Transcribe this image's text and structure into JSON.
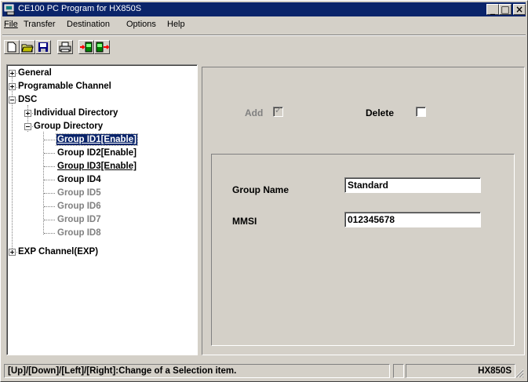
{
  "window": {
    "title": "CE100  PC Program for HX850S",
    "controls": [
      "minimize-icon",
      "maximize-icon",
      "close-icon"
    ]
  },
  "menu": {
    "file": "File",
    "transfer": "Transfer",
    "destination": "Destination",
    "options": "Options",
    "help": "Help"
  },
  "toolbar": {
    "buttons": [
      "new-file-icon",
      "open-folder-icon",
      "save-icon",
      "print-icon",
      "download-from-radio-icon",
      "upload-to-radio-icon"
    ]
  },
  "tree": {
    "general": "General",
    "programable_channel": "Programable Channel",
    "dsc": "DSC",
    "individual_directory": "Individual Directory",
    "group_directory": "Group Directory",
    "group_id1": "Group ID1[Enable]",
    "group_id2": "Group ID2[Enable]",
    "group_id3": "Group ID3[Enable]",
    "group_id4": "Group ID4",
    "group_id5": "Group ID5",
    "group_id6": "Group ID6",
    "group_id7": "Group ID7",
    "group_id8": "Group ID8",
    "exp_channel": "EXP Channel(EXP)"
  },
  "panel": {
    "add_label": "Add",
    "add_checked": true,
    "delete_label": "Delete",
    "delete_checked": false,
    "group_name_label": "Group Name",
    "group_name_value": "Standard",
    "mmsi_label": "MMSI",
    "mmsi_value": "012345678"
  },
  "status": {
    "hint": "[Up]/[Down]/[Left]/[Right]:Change of a Selection item.",
    "model": "HX850S"
  }
}
